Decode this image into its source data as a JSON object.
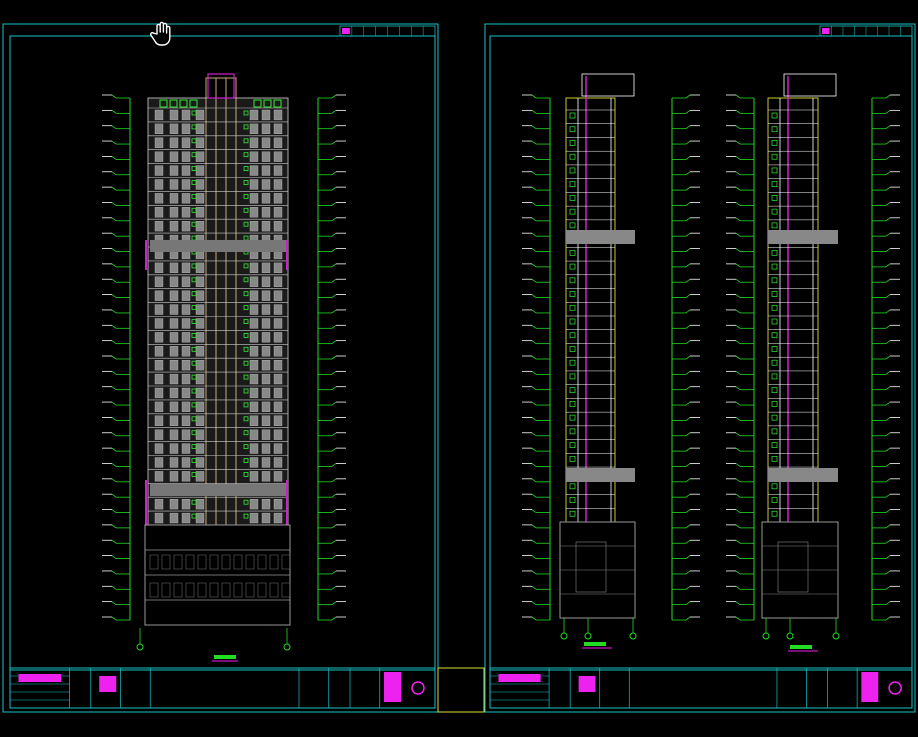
{
  "viewport": {
    "background": "#000000",
    "cursor_icon": "hand-pan-icon"
  },
  "colors": {
    "frame": "#17c4c4",
    "level_marks": "#22dd22",
    "facade": "#aaaaaa",
    "accent_magenta": "#cc22cc",
    "core_tan": "#c8a878",
    "window_green": "#33ee33",
    "title_magenta": "#ee22ee",
    "yellow": "#dddd33",
    "white": "#ffffff"
  },
  "sheets": [
    {
      "id": "sheet-left",
      "view": "front-elevation",
      "floors_above_podium": 30,
      "podium_floors": 4
    },
    {
      "id": "sheet-right",
      "view": "side-elevations",
      "floors_above_podium": 30,
      "podium_floors": 4
    }
  ]
}
